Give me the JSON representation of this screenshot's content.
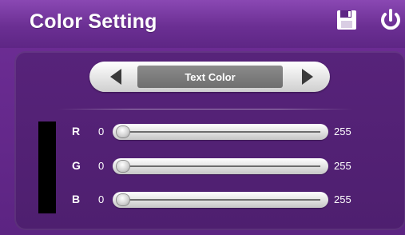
{
  "title": "Color Setting",
  "icons": {
    "save": "save-icon",
    "power": "power-icon"
  },
  "selector": {
    "value": "Text Color"
  },
  "preview": {
    "color": "#000000"
  },
  "sliders": [
    {
      "channel": "R",
      "min": "0",
      "max": "255",
      "value": 0
    },
    {
      "channel": "G",
      "min": "0",
      "max": "255",
      "value": 0
    },
    {
      "channel": "B",
      "min": "0",
      "max": "255",
      "value": 0
    }
  ],
  "colors": {
    "background": "#6a2f8f",
    "panel": "#52217a",
    "text": "#ffffff"
  }
}
